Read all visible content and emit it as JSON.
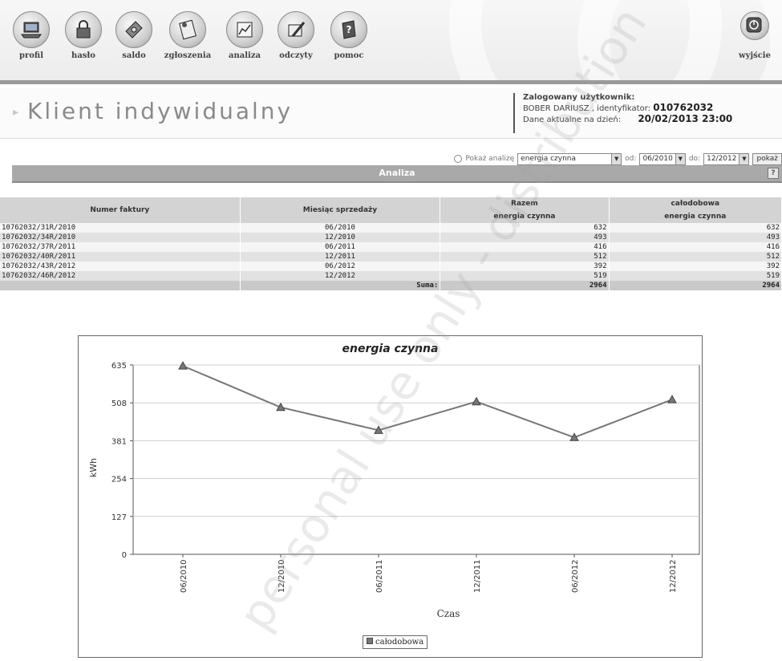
{
  "nav": {
    "items": [
      {
        "label": "profil",
        "icon": "laptop-icon"
      },
      {
        "label": "hasło",
        "icon": "lock-icon"
      },
      {
        "label": "saldo",
        "icon": "money-icon"
      },
      {
        "label": "zgłoszenia",
        "icon": "notes-icon"
      },
      {
        "label": "analiza",
        "icon": "chart-icon"
      },
      {
        "label": "odczyty",
        "icon": "pencil-icon"
      },
      {
        "label": "pomoc",
        "icon": "help-book-icon"
      }
    ],
    "exit_label": "wyjście"
  },
  "header": {
    "title": "Klient indywidualny",
    "user_label": "Zalogowany użytkownik:",
    "user_name": "BOBER DARIUSZ , identyfikator:",
    "user_id": "010762032",
    "date_label": "Dane aktualne na dzień:",
    "date_value": "20/02/2013 23:00"
  },
  "filter": {
    "label": "Pokaż analizę",
    "type_value": "energia czynna",
    "from_label": "od:",
    "from_value": "06/2010",
    "to_label": "do:",
    "to_value": "12/2012",
    "button_label": "pokaż"
  },
  "section": {
    "title": "Analiza",
    "help": "?"
  },
  "table": {
    "headers": {
      "invoice": "Numer faktury",
      "month": "Miesiąc sprzedaży",
      "razem": "Razem",
      "razem_sub": "energia czynna",
      "calodobowa": "całodobowa",
      "calodobowa_sub": "energia czynna"
    },
    "rows": [
      {
        "invoice": "10762032/31R/2010",
        "month": "06/2010",
        "razem": "632",
        "calodobowa": "632"
      },
      {
        "invoice": "10762032/34R/2010",
        "month": "12/2010",
        "razem": "493",
        "calodobowa": "493"
      },
      {
        "invoice": "10762032/37R/2011",
        "month": "06/2011",
        "razem": "416",
        "calodobowa": "416"
      },
      {
        "invoice": "10762032/40R/2011",
        "month": "12/2011",
        "razem": "512",
        "calodobowa": "512"
      },
      {
        "invoice": "10762032/43R/2012",
        "month": "06/2012",
        "razem": "392",
        "calodobowa": "392"
      },
      {
        "invoice": "10762032/46R/2012",
        "month": "12/2012",
        "razem": "519",
        "calodobowa": "519"
      }
    ],
    "sum_label": "Suma:",
    "sum_razem": "2964",
    "sum_calodobowa": "2964"
  },
  "watermark": "personal use only - distribution",
  "chart_data": {
    "type": "line",
    "title": "energia czynna",
    "xlabel": "Czas",
    "ylabel": "kWh",
    "categories": [
      "06/2010",
      "12/2010",
      "06/2011",
      "12/2011",
      "06/2012",
      "12/2012"
    ],
    "yticks": [
      0,
      127,
      254,
      381,
      508,
      635
    ],
    "ylim": [
      0,
      635
    ],
    "grid": true,
    "legend": "bottom-center",
    "series": [
      {
        "name": "całodobowa",
        "values": [
          632,
          493,
          416,
          512,
          392,
          519
        ],
        "color": "#777777"
      }
    ]
  }
}
